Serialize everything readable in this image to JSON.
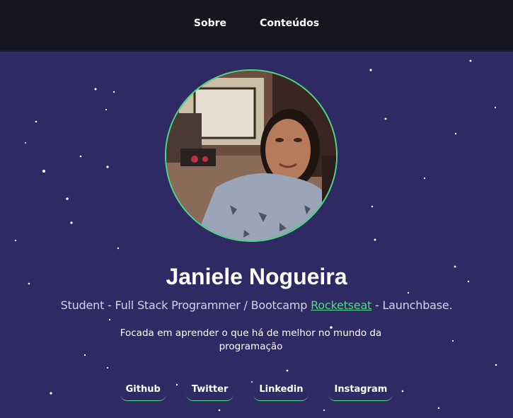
{
  "nav": {
    "items": [
      {
        "label": "Sobre"
      },
      {
        "label": "Conteúdos"
      }
    ]
  },
  "profile": {
    "name": "Janiele Nogueira",
    "role_prefix": "Student - Full Stack Programmer / Bootcamp ",
    "role_link": "Rocketseat",
    "role_suffix": " - Launchbase.",
    "bio": "Focada em aprender o que há de melhor no mundo da programação"
  },
  "links": [
    {
      "label": "Github"
    },
    {
      "label": "Twitter"
    },
    {
      "label": "Linkedin"
    },
    {
      "label": "Instagram"
    }
  ],
  "colors": {
    "background": "#2f2a63",
    "header": "#15161f",
    "accent": "#4bdc83",
    "text": "#ffffff"
  }
}
